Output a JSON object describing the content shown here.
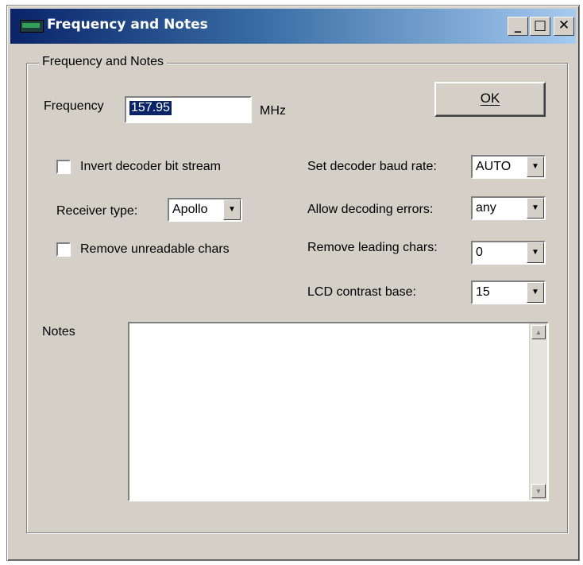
{
  "window": {
    "title": "Frequency and Notes",
    "controls": {
      "minimize": "_",
      "maximize": "□",
      "close": "✕"
    }
  },
  "group": {
    "label": "Frequency and Notes"
  },
  "frequency": {
    "label": "Frequency",
    "value": "157.95",
    "unit": "MHz"
  },
  "ok_button": {
    "label": "OK"
  },
  "left": {
    "invert_label": "Invert decoder bit stream",
    "receiver_label": "Receiver type:",
    "receiver_value": "Apollo",
    "remove_unreadable_label": "Remove unreadable chars"
  },
  "right": {
    "baud_label": "Set decoder baud rate:",
    "baud_value": "AUTO",
    "errors_label": "Allow decoding errors:",
    "errors_value": "any",
    "leading_label": "Remove leading chars:",
    "leading_value": "0",
    "lcd_label": "LCD contrast base:",
    "lcd_value": "15"
  },
  "notes": {
    "label": "Notes",
    "value": ""
  },
  "icons": {
    "app": "app-icon",
    "dropdown": "chevron-down-icon",
    "scroll_up": "scroll-up-icon",
    "scroll_down": "scroll-down-icon"
  },
  "colors": {
    "titlebar_start": "#0a246a",
    "titlebar_end": "#a6caf0",
    "face": "#d4d0c8",
    "selection": "#0a246a"
  }
}
